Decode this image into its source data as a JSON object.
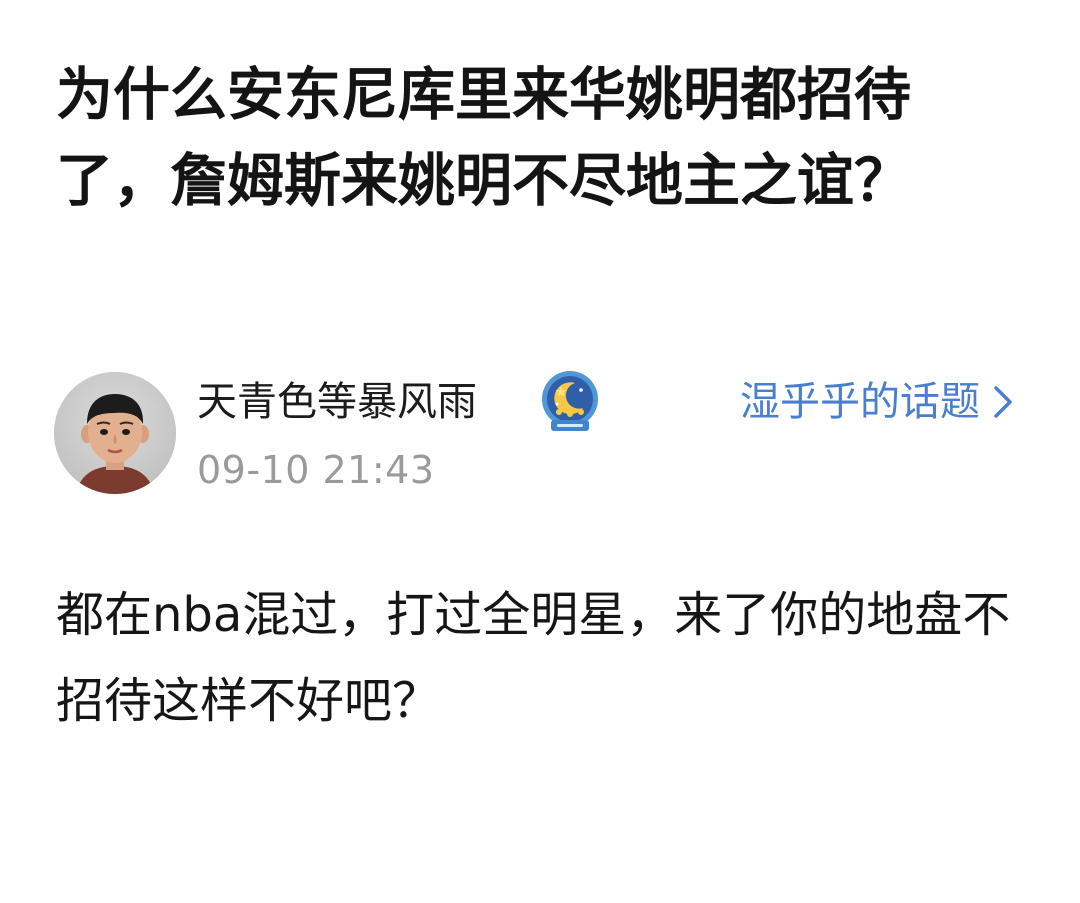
{
  "question": {
    "title": "为什么安东尼库里来华姚明都招待了，詹姆斯来姚明不尽地主之谊？"
  },
  "author": {
    "name": "天青色等暴风雨",
    "timestamp": "09-10 21:43",
    "avatar_icon": "child-portrait-avatar",
    "badge_icon": "moon-star-badge-icon",
    "badge_colors": {
      "ring": "#4f97d6",
      "inner": "#2f5fa8",
      "moon": "#f6c846",
      "ribbon": "#3f86cf"
    }
  },
  "topic_link": {
    "label": "湿乎乎的话题",
    "icon": "chevron-right-icon",
    "color": "#4a7fd0"
  },
  "answer": {
    "text": "都在nba混过，打过全明星，来了你的地盘不招待这样不好吧？"
  }
}
